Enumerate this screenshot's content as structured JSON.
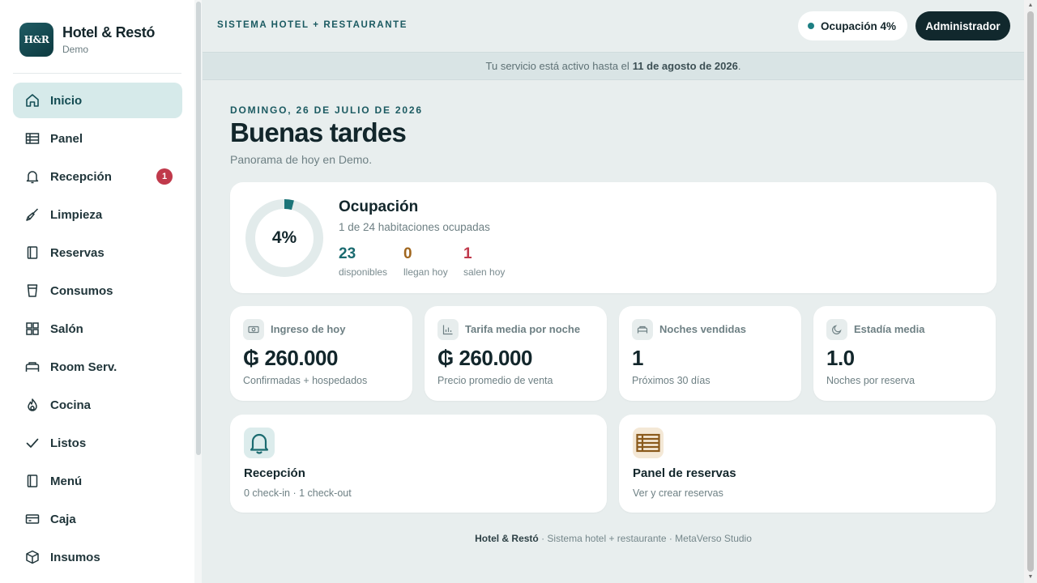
{
  "sidebar": {
    "logo_text": "H&R",
    "brand_name": "Hotel & Restó",
    "brand_sub": "Demo",
    "items": [
      {
        "label": "Inicio",
        "icon": "home-icon",
        "active": true
      },
      {
        "label": "Panel",
        "icon": "grid-table-icon"
      },
      {
        "label": "Recepción",
        "icon": "bell-icon",
        "badge": "1"
      },
      {
        "label": "Limpieza",
        "icon": "broom-icon"
      },
      {
        "label": "Reservas",
        "icon": "book-icon"
      },
      {
        "label": "Consumos",
        "icon": "cup-icon"
      },
      {
        "label": "Salón",
        "icon": "tables-icon"
      },
      {
        "label": "Room Serv.",
        "icon": "bed-icon"
      },
      {
        "label": "Cocina",
        "icon": "flame-icon"
      },
      {
        "label": "Listos",
        "icon": "check-icon"
      },
      {
        "label": "Menú",
        "icon": "menu-book-icon"
      },
      {
        "label": "Caja",
        "icon": "cash-register-icon"
      },
      {
        "label": "Insumos",
        "icon": "box-icon"
      }
    ]
  },
  "header": {
    "title": "SISTEMA HOTEL + RESTAURANTE",
    "occupancy_pill": "Ocupación 4%",
    "admin_button": "Administrador"
  },
  "notice": {
    "prefix": "Tu servicio está activo hasta el",
    "date": "11 de agosto de 2026",
    "suffix": "."
  },
  "main": {
    "date": "DOMINGO, 26 DE JULIO DE 2026",
    "greeting": "Buenas tardes",
    "subtitle": "Panorama de hoy en Demo.",
    "occupancy": {
      "percent_label": "4%",
      "percent_value": 4,
      "title": "Ocupación",
      "subtitle": "1 de 24 habitaciones ocupadas",
      "stats": [
        {
          "value": "23",
          "caption": "disponibles",
          "color": "#1b6b70"
        },
        {
          "value": "0",
          "caption": "llegan hoy",
          "color": "#a0661e"
        },
        {
          "value": "1",
          "caption": "salen hoy",
          "color": "#c0394b"
        }
      ]
    },
    "kpis": [
      {
        "label": "Ingreso de hoy",
        "value": "₲ 260.000",
        "caption": "Confirmadas + hospedados",
        "icon": "money-icon"
      },
      {
        "label": "Tarifa media por noche",
        "value": "₲ 260.000",
        "caption": "Precio promedio de venta",
        "icon": "bar-chart-icon"
      },
      {
        "label": "Noches vendidas",
        "value": "1",
        "caption": "Próximos 30 días",
        "icon": "bed-icon"
      },
      {
        "label": "Estadía media",
        "value": "1.0",
        "caption": "Noches por reserva",
        "icon": "moon-icon"
      }
    ],
    "actions": [
      {
        "title": "Recepción",
        "subtitle": "0 check-in · 1 check-out",
        "icon": "bell-icon"
      },
      {
        "title": "Panel de reservas",
        "subtitle": "Ver y crear reservas",
        "icon": "grid-table-icon"
      }
    ]
  },
  "footer": {
    "brand": "Hotel & Restó",
    "text": " · Sistema hotel + restaurante · MetaVerso Studio"
  },
  "colors": {
    "accent": "#1b5a61",
    "active_bg": "#d6eaea",
    "badge": "#c0394b",
    "dark": "#11282d"
  }
}
